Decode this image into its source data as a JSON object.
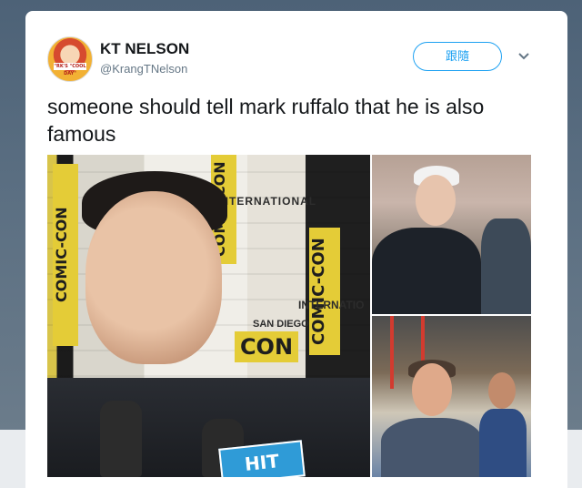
{
  "tweet": {
    "author_name": "KT NELSON",
    "author_handle": "@KrangTNelson",
    "follow_label": "跟隨",
    "text": "someone should tell mark ruffalo that he is also famous",
    "avatar_text": "\"RK'S \"COOL DAY\""
  },
  "media": {
    "main_signs": {
      "comic_con": "COMIC-CON",
      "international": "INTERNATIONAL",
      "san_diego": "SAN DIEGO",
      "con": "CON",
      "internatio": "INTERNATIO",
      "hit_fix": "HIT"
    }
  },
  "colors": {
    "accent": "#1da1f2",
    "text": "#14171a",
    "muted": "#657786"
  },
  "icons": {
    "more": "chevron-down-icon"
  }
}
